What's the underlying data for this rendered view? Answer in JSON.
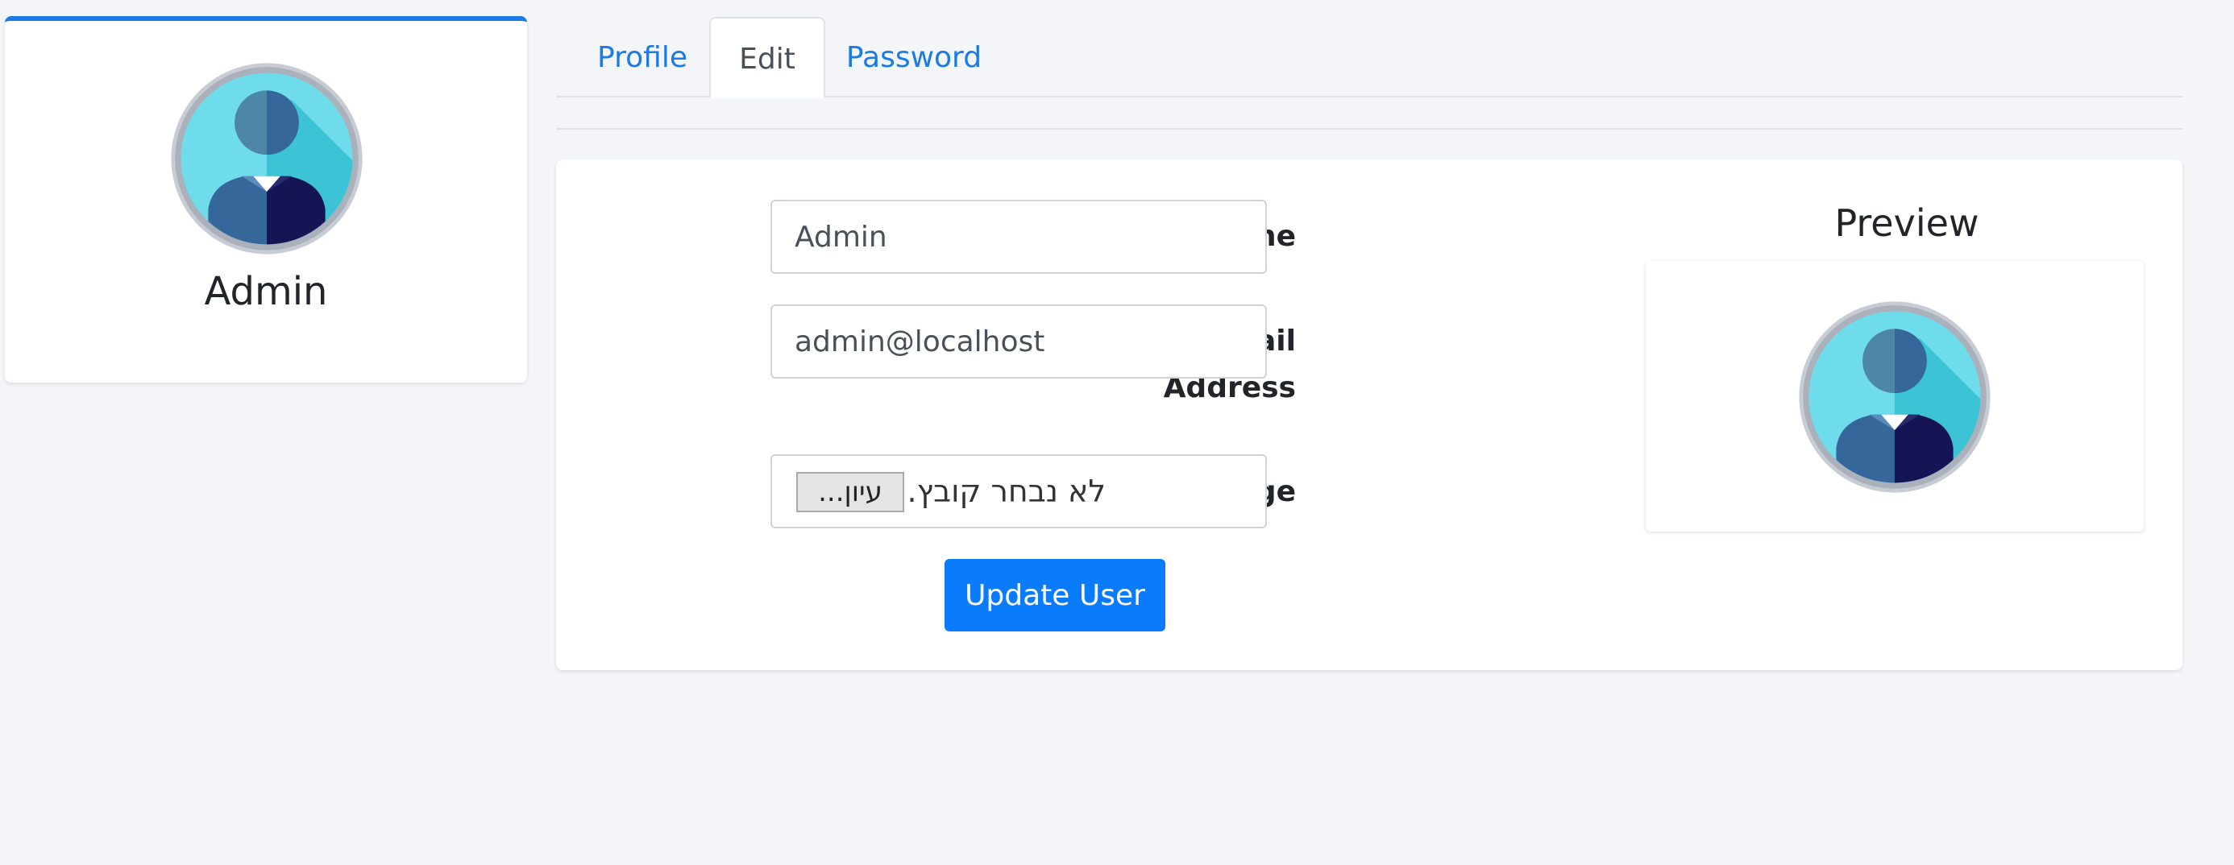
{
  "profile": {
    "name": "Admin",
    "avatar_icon": "user-avatar-icon"
  },
  "tabs": [
    {
      "label": "Profile",
      "active": false
    },
    {
      "label": "Edit",
      "active": true
    },
    {
      "label": "Password",
      "active": false
    }
  ],
  "form": {
    "name_label": "Name",
    "name_value": "Admin",
    "email_label_line1": "E-Mail",
    "email_label_line2": "Address",
    "email_value": "admin@localhost",
    "image_label": "Image",
    "file_browse_label": "עיון...",
    "file_status": "לא נבחר קובץ.",
    "submit_label": "Update User"
  },
  "preview": {
    "title": "Preview"
  },
  "colors": {
    "accent": "#1a7ae6",
    "button": "#0a7cfb",
    "background": "#f4f5f9"
  }
}
